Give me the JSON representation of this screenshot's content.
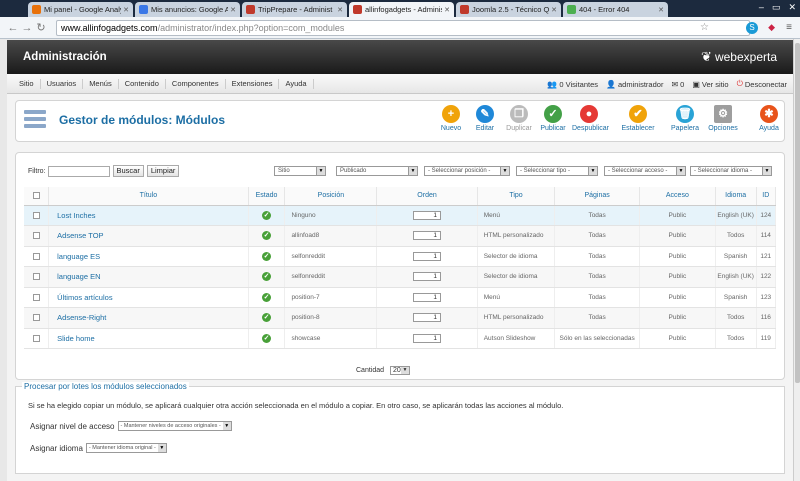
{
  "browser": {
    "tabs": [
      {
        "title": "Mi panel - Google Analyt",
        "color": "#e8710a"
      },
      {
        "title": "Mis anuncios: Google Ad",
        "color": "#3b78e7"
      },
      {
        "title": "TripPrepare - Administ",
        "color": "#c0392b"
      },
      {
        "title": "allinfogadgets - Adminis",
        "color": "#c0392b"
      },
      {
        "title": "Joomla 2.5 - Técnico Qdo",
        "color": "#c0392b"
      },
      {
        "title": "404 - Error 404",
        "color": "#4caf50"
      }
    ],
    "url_domain": "www.allinfogadgets.com",
    "url_path": "/administrator/index.php?option=com_modules"
  },
  "header": {
    "title": "Administración",
    "logo_text": "webexperta"
  },
  "menu": [
    "Sitio",
    "Usuarios",
    "Menús",
    "Contenido",
    "Componentes",
    "Extensiones",
    "Ayuda"
  ],
  "status": {
    "visitors": "0 Visitantes",
    "admins": "administrador",
    "mail": "0",
    "site": "Ver sitio",
    "logout": "Desconectar"
  },
  "toolbar": {
    "page_title": "Gestor de módulos: Módulos",
    "buttons": [
      {
        "label": "Nuevo",
        "icon": "+",
        "color": "#f0a30a"
      },
      {
        "label": "Editar",
        "icon": "✎",
        "color": "#1f88d8"
      },
      {
        "label": "Duplicar",
        "icon": "❐",
        "color": "#bbbbbb"
      },
      {
        "label": "Publicar",
        "icon": "✓",
        "color": "#43a047"
      },
      {
        "label": "Despublicar",
        "icon": "●",
        "color": "#e53935"
      },
      {
        "label": "Establecer",
        "icon": "✔",
        "color": "#f0a30a"
      },
      {
        "label": "Papelera",
        "icon": "🗑",
        "color": "#29a3d6"
      },
      {
        "label": "Opciones",
        "icon": "⚙",
        "color": "#9e9e9e"
      },
      {
        "label": "Ayuda",
        "icon": "✱",
        "color": "#e8531a"
      }
    ]
  },
  "filters": {
    "label": "Filtro:",
    "search_value": "",
    "search_button": "Buscar",
    "clear_button": "Limpiar",
    "selects": [
      "Sitio",
      "Publicado",
      "- Seleccionar posición -",
      "- Seleccionar tipo -",
      "- Seleccionar acceso -",
      "- Seleccionar idioma -"
    ]
  },
  "table": {
    "headers": [
      "Título",
      "Estado",
      "Posición",
      "Orden",
      "Tipo",
      "Páginas",
      "Acceso",
      "Idioma",
      "ID"
    ],
    "rows": [
      {
        "title": "Lost Inches",
        "position": "Ninguno",
        "order": "1",
        "type": "Menú",
        "pages": "Todas",
        "access": "Public",
        "lang": "English (UK)",
        "id": "124"
      },
      {
        "title": "Adsense TOP",
        "position": "allinfoad8",
        "order": "1",
        "type": "HTML personalizado",
        "pages": "Todas",
        "access": "Public",
        "lang": "Todos",
        "id": "114"
      },
      {
        "title": "language ES",
        "position": "selfonreddit",
        "order": "1",
        "type": "Selector de idioma",
        "pages": "Todas",
        "access": "Public",
        "lang": "Spanish",
        "id": "121"
      },
      {
        "title": "language EN",
        "position": "selfonreddit",
        "order": "1",
        "type": "Selector de idioma",
        "pages": "Todas",
        "access": "Public",
        "lang": "English (UK)",
        "id": "122"
      },
      {
        "title": "Últimos artículos",
        "position": "position-7",
        "order": "1",
        "type": "Menú",
        "pages": "Todas",
        "access": "Public",
        "lang": "Spanish",
        "id": "123"
      },
      {
        "title": "Adsense-Right",
        "position": "position-8",
        "order": "1",
        "type": "HTML personalizado",
        "pages": "Todas",
        "access": "Public",
        "lang": "Todos",
        "id": "116"
      },
      {
        "title": "Slide home",
        "position": "showcase",
        "order": "1",
        "type": "Autson Slideshow",
        "pages": "Sólo en las seleccionadas",
        "access": "Public",
        "lang": "Todos",
        "id": "119"
      }
    ]
  },
  "pagination": {
    "label": "Cantidad",
    "value": "20"
  },
  "batch": {
    "legend": "Procesar por lotes los módulos seleccionados",
    "tip": "Si se ha elegido copiar un módulo, se aplicará cualquier otra acción seleccionada en el módulo a copiar. En otro caso, se aplicarán todas las acciones al módulo.",
    "access_label": "Asignar nivel de acceso",
    "access_value": "- Mantener niveles de acceso originales -",
    "lang_label": "Asignar idioma",
    "lang_value": "- Mantener idioma original -"
  }
}
